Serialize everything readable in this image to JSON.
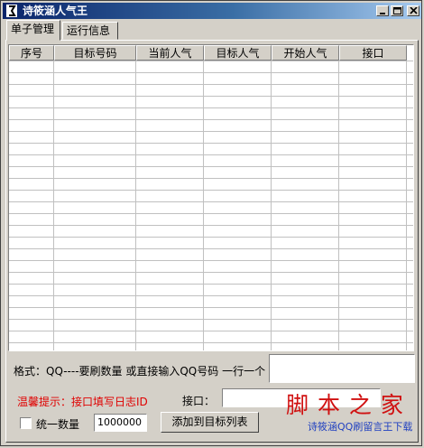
{
  "window": {
    "title": "诗筱涵人气王"
  },
  "tabs": [
    {
      "label": "单子管理"
    },
    {
      "label": "运行信息"
    }
  ],
  "table": {
    "columns": [
      "序号",
      "目标号码",
      "当前人气",
      "目标人气",
      "开始人气",
      "接口"
    ],
    "rows": []
  },
  "form": {
    "format_hint": "格式：QQ----要刷数量 或直接输入QQ号码 一行一个",
    "warm_tip": "温馨提示：接口填写日志ID",
    "interface_label": "接口：",
    "interface_value": "",
    "unify_label": "统一数量",
    "unify_checked": false,
    "quantity_value": "1000000",
    "add_button": "添加到目标列表",
    "qq_input_value": ""
  },
  "watermark": {
    "logo_text": "脚 本 之 家",
    "sub_text": "诗筱涵QQ刷留言王下载"
  },
  "colors": {
    "title_gradient_start": "#0a246a",
    "warning_red": "#e00000"
  }
}
